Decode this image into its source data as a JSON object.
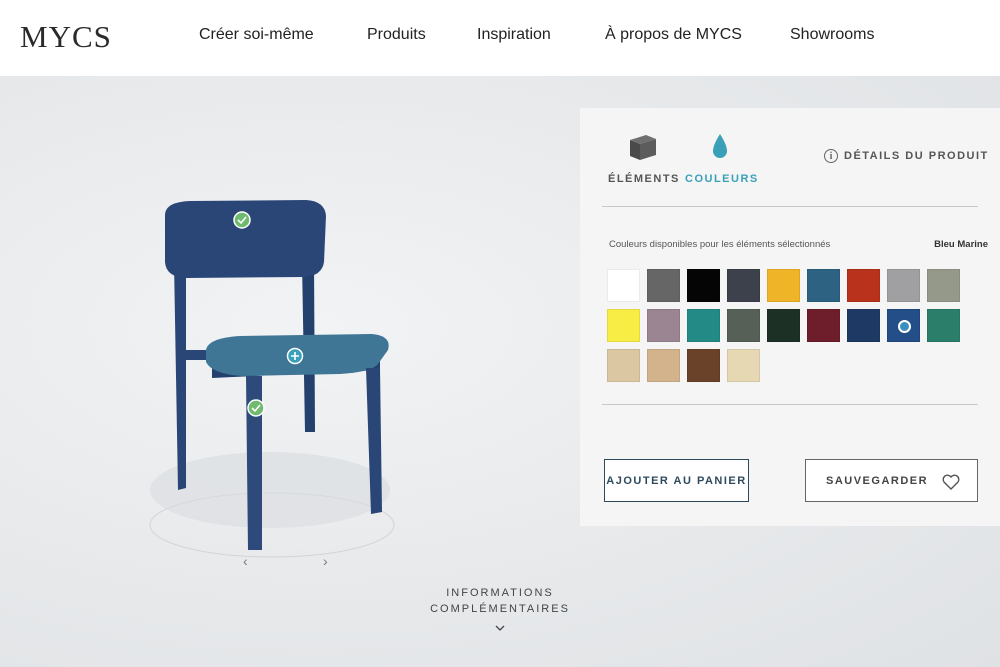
{
  "header": {
    "logo": "MYCS",
    "nav": [
      {
        "label": "Créer soi-même"
      },
      {
        "label": "Produits"
      },
      {
        "label": "Inspiration"
      },
      {
        "label": "À propos de MYCS"
      },
      {
        "label": "Showrooms"
      }
    ]
  },
  "stage": {
    "rotate_left": "‹",
    "rotate_right": "›",
    "more_info_line1": "INFORMATIONS",
    "more_info_line2": "COMPLÉMENTAIRES"
  },
  "panel": {
    "tabs": {
      "elements": "ÉLÉMENTS",
      "colors": "COULEURS"
    },
    "details_label": "DÉTAILS DU PRODUIT",
    "colors_caption": "Couleurs disponibles pour les éléments sélectionnés",
    "selected_color_name": "Bleu Marine",
    "swatches": [
      "#ffffff",
      "#666666",
      "#050505",
      "#3d414b",
      "#f0b428",
      "#2d6282",
      "#b8321c",
      "#a0a0a3",
      "#94998a",
      "#f7ed45",
      "#9b8593",
      "#238a85",
      "#566056",
      "#1c3026",
      "#6e1d2a",
      "#1e3a64",
      "#234e87",
      "#2b7e69",
      "#dcc7a3",
      "#d3b38b",
      "#6a4229",
      "#e6d8b3"
    ],
    "selected_swatch_index": 16,
    "add_to_cart": "AJOUTER AU PANIER",
    "save": "SAUVEGARDER"
  },
  "colors": {
    "chair_frame": "#2d4a7a",
    "chair_seat": "#3f7595",
    "accent": "#3aa0b8",
    "check_badge": "#6fba6f"
  }
}
